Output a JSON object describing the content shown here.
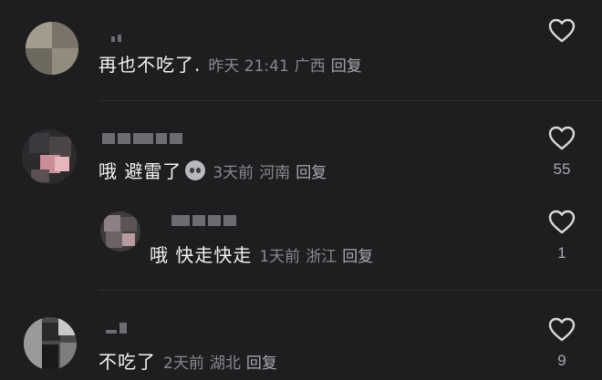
{
  "comments": [
    {
      "text": "再也不吃了.",
      "time": "昨天 21:41",
      "location": "广西",
      "reply_label": "回复",
      "like_count": ""
    },
    {
      "text": "哦 避雷了",
      "emoji": "ghost-emoji",
      "time": "3天前",
      "location": "河南",
      "reply_label": "回复",
      "like_count": "55"
    },
    {
      "text": "哦 快走快走",
      "time": "1天前",
      "location": "浙江",
      "reply_label": "回复",
      "like_count": "1"
    },
    {
      "text": "不吃了",
      "time": "2天前",
      "location": "湖北",
      "reply_label": "回复",
      "like_count": "9"
    }
  ],
  "colors": {
    "background": "#1e1e20",
    "text": "#f2f2f3",
    "meta": "#8a8a8e",
    "icon": "#d9d9dc"
  }
}
